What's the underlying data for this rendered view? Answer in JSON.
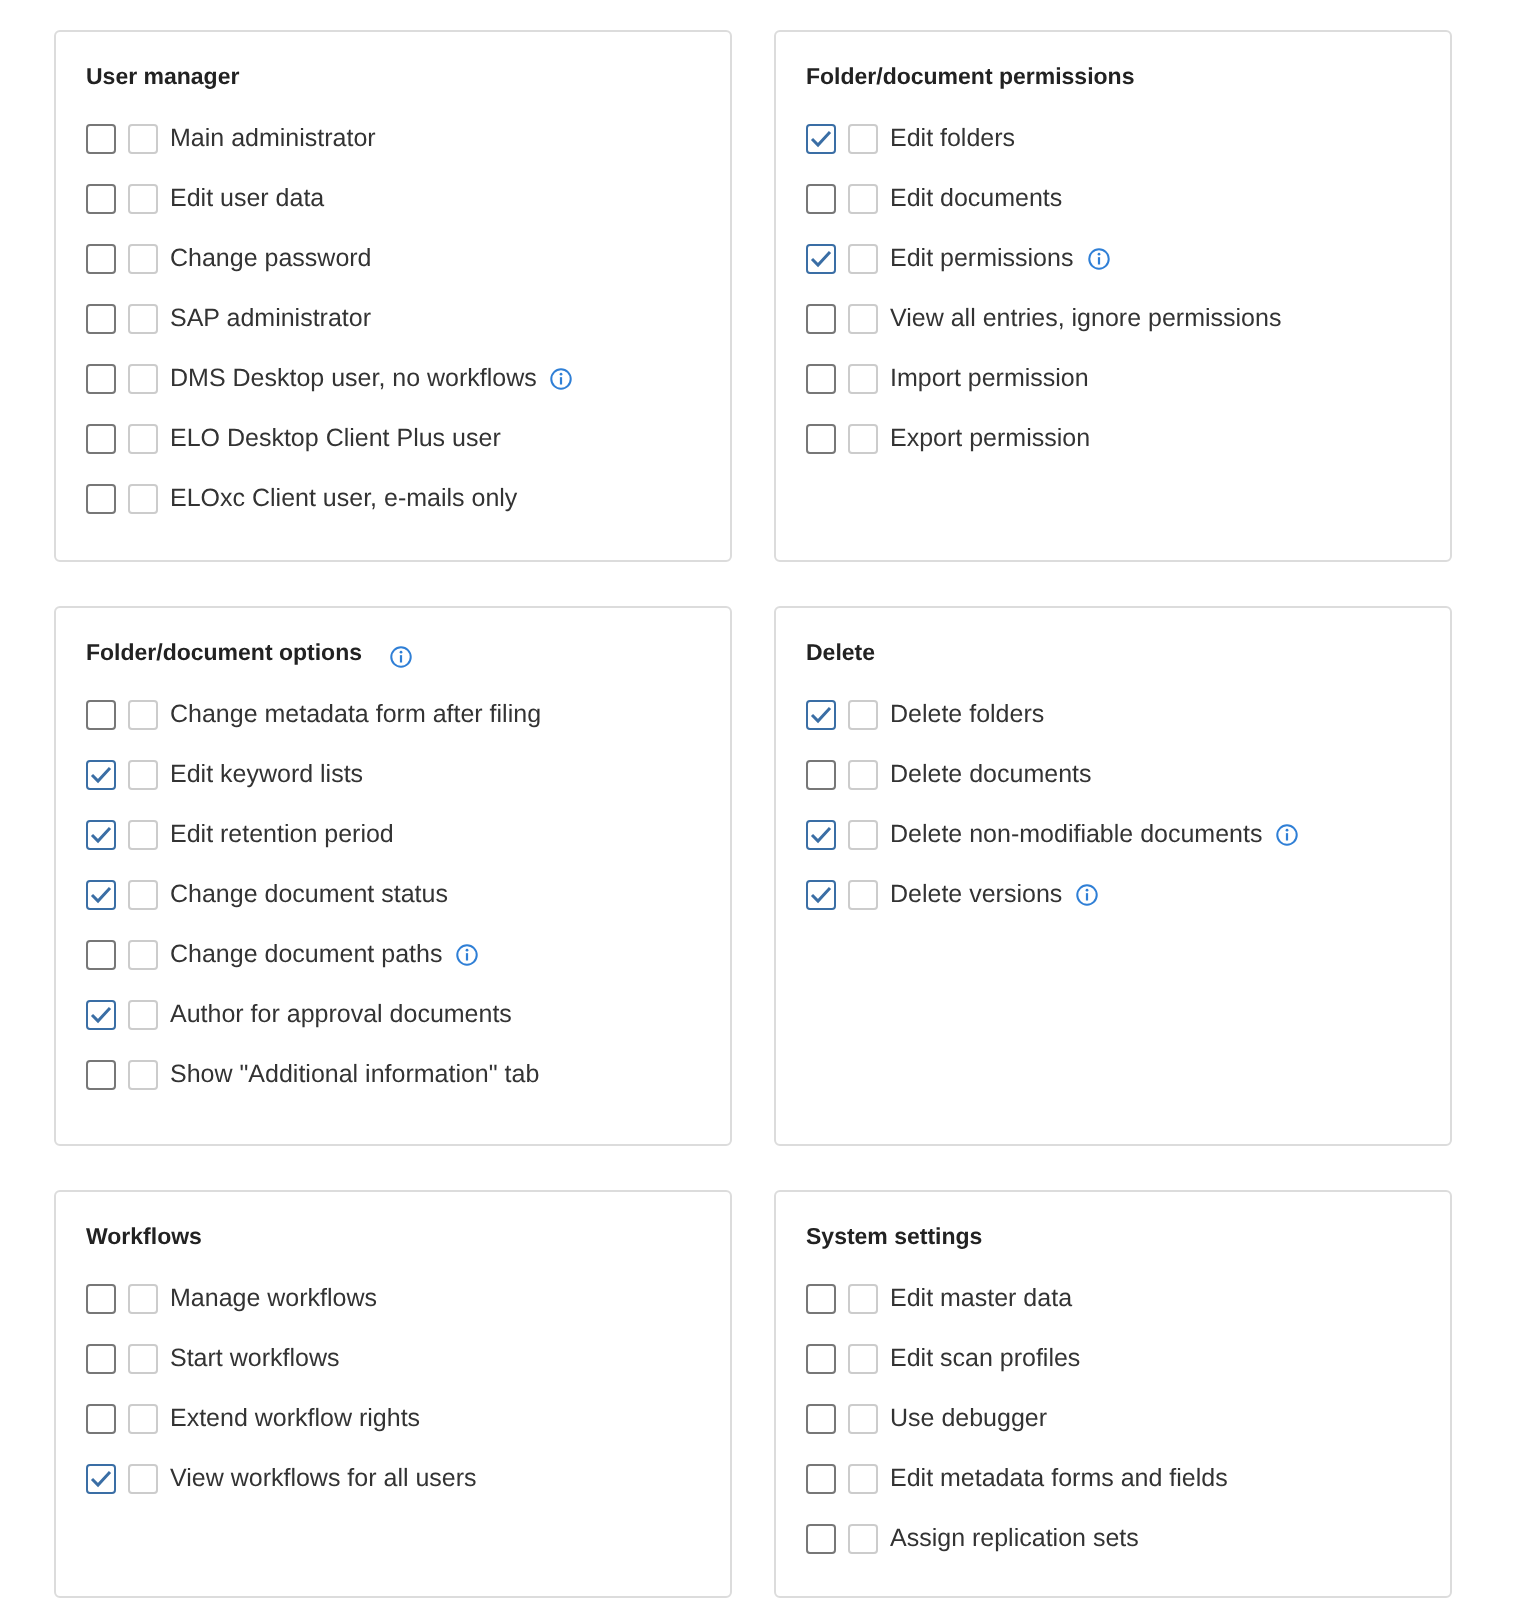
{
  "panels": [
    {
      "title": "User manager",
      "info": false,
      "items": [
        {
          "label": "Main administrator",
          "checked": false,
          "inherited": false,
          "info": false
        },
        {
          "label": "Edit user data",
          "checked": false,
          "inherited": false,
          "info": false
        },
        {
          "label": "Change password",
          "checked": false,
          "inherited": false,
          "info": false
        },
        {
          "label": "SAP administrator",
          "checked": false,
          "inherited": false,
          "info": false
        },
        {
          "label": "DMS Desktop user, no workflows",
          "checked": false,
          "inherited": false,
          "info": true
        },
        {
          "label": "ELO Desktop Client Plus user",
          "checked": false,
          "inherited": false,
          "info": false
        },
        {
          "label": "ELOxc Client user, e-mails only",
          "checked": false,
          "inherited": false,
          "info": false
        }
      ]
    },
    {
      "title": "Folder/document permissions",
      "info": false,
      "items": [
        {
          "label": "Edit folders",
          "checked": true,
          "inherited": false,
          "info": false
        },
        {
          "label": "Edit documents",
          "checked": false,
          "inherited": false,
          "info": false
        },
        {
          "label": "Edit permissions",
          "checked": true,
          "inherited": false,
          "info": true
        },
        {
          "label": "View all entries, ignore permissions",
          "checked": false,
          "inherited": false,
          "info": false
        },
        {
          "label": "Import permission",
          "checked": false,
          "inherited": false,
          "info": false
        },
        {
          "label": "Export permission",
          "checked": false,
          "inherited": false,
          "info": false
        }
      ]
    },
    {
      "title": "Folder/document options",
      "info": true,
      "items": [
        {
          "label": "Change metadata form after filing",
          "checked": false,
          "inherited": false,
          "info": false
        },
        {
          "label": "Edit keyword lists",
          "checked": true,
          "inherited": false,
          "info": false
        },
        {
          "label": "Edit retention period",
          "checked": true,
          "inherited": false,
          "info": false
        },
        {
          "label": "Change document status",
          "checked": true,
          "inherited": false,
          "info": false
        },
        {
          "label": "Change document paths",
          "checked": false,
          "inherited": false,
          "info": true
        },
        {
          "label": "Author for approval documents",
          "checked": true,
          "inherited": false,
          "info": false
        },
        {
          "label": "Show \"Additional information\" tab",
          "checked": false,
          "inherited": false,
          "info": false
        }
      ]
    },
    {
      "title": "Delete",
      "info": false,
      "items": [
        {
          "label": "Delete folders",
          "checked": true,
          "inherited": false,
          "info": false
        },
        {
          "label": "Delete documents",
          "checked": false,
          "inherited": false,
          "info": false
        },
        {
          "label": "Delete non-modifiable documents",
          "checked": true,
          "inherited": false,
          "info": true
        },
        {
          "label": "Delete versions",
          "checked": true,
          "inherited": false,
          "info": true
        }
      ]
    },
    {
      "title": "Workflows",
      "info": false,
      "items": [
        {
          "label": "Manage workflows",
          "checked": false,
          "inherited": false,
          "info": false
        },
        {
          "label": "Start workflows",
          "checked": false,
          "inherited": false,
          "info": false
        },
        {
          "label": "Extend workflow rights",
          "checked": false,
          "inherited": false,
          "info": false
        },
        {
          "label": "View workflows for all users",
          "checked": true,
          "inherited": false,
          "info": false
        }
      ]
    },
    {
      "title": "System settings",
      "info": false,
      "items": [
        {
          "label": "Edit master data",
          "checked": false,
          "inherited": false,
          "info": false
        },
        {
          "label": "Edit scan profiles",
          "checked": false,
          "inherited": false,
          "info": false
        },
        {
          "label": "Use debugger",
          "checked": false,
          "inherited": false,
          "info": false
        },
        {
          "label": "Edit metadata forms and fields",
          "checked": false,
          "inherited": false,
          "info": false
        },
        {
          "label": "Assign replication sets",
          "checked": false,
          "inherited": false,
          "info": false
        }
      ]
    }
  ]
}
